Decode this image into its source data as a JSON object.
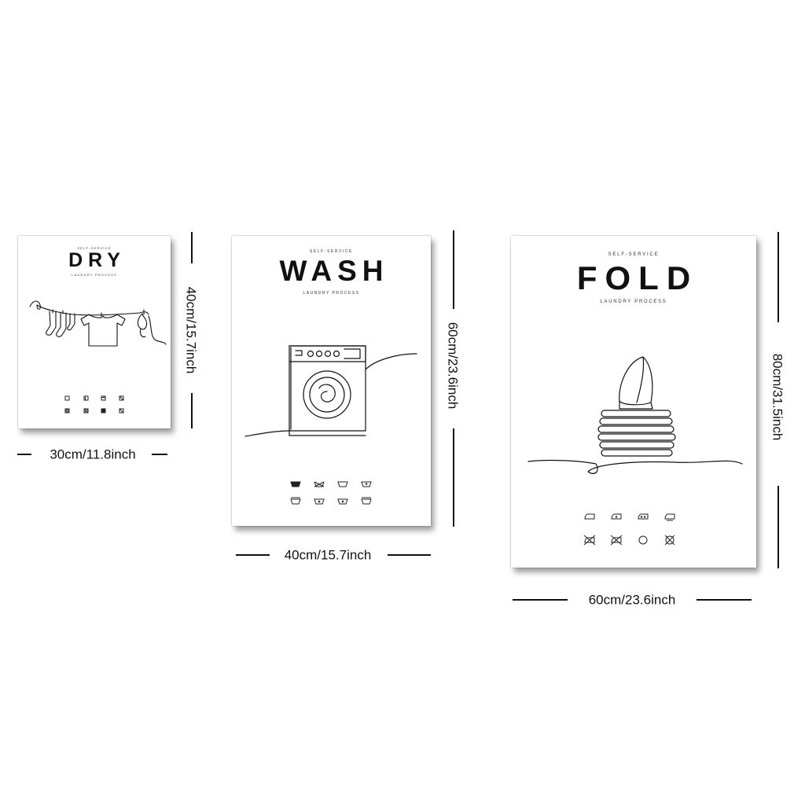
{
  "posters": {
    "dry": {
      "tagline": "SELF-SERVICE",
      "title": "DRY",
      "subtitle": "LAUNDRY PROCESS",
      "illustration": "clothesline-icon",
      "width_label": "30cm/11.8inch",
      "height_label": "40cm/15.7inch"
    },
    "wash": {
      "tagline": "SELF-SERVICE",
      "title": "WASH",
      "subtitle": "LAUNDRY PROCESS",
      "illustration": "washing-machine-icon",
      "width_label": "40cm/15.7inch",
      "height_label": "60cm/23.6inch"
    },
    "fold": {
      "tagline": "SELF-SERVICE",
      "title": "FOLD",
      "subtitle": "LAUNDRY PROCESS",
      "illustration": "iron-on-folded-clothes-icon",
      "width_label": "60cm/23.6inch",
      "height_label": "80cm/31.5inch"
    }
  },
  "colors": {
    "ink": "#111111",
    "background": "#ffffff",
    "poster": "#ffffff"
  }
}
